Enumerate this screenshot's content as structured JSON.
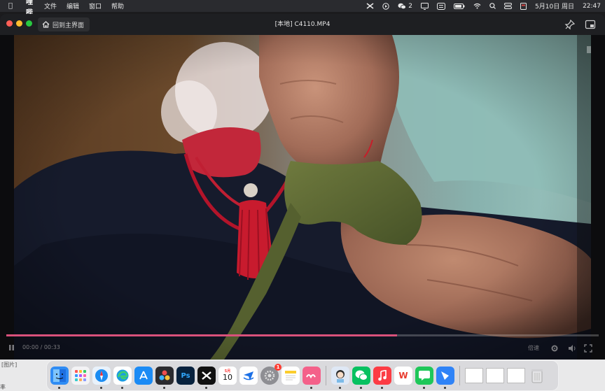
{
  "menubar": {
    "app_name": "哔哩哔哩",
    "items": [
      "文件",
      "编辑",
      "窗口",
      "帮助"
    ],
    "wechat_count": "2",
    "date": "5月10日 周日",
    "time": "22:47"
  },
  "window": {
    "home_button": "回到主界面",
    "title": "[本地] C4110.MP4"
  },
  "player": {
    "progress_fraction": 0.66,
    "time_display": "00:00 / 00:33",
    "speed_label": "倍速"
  },
  "desktop": {
    "file_label": "[图片]",
    "bottom_char": "丰"
  },
  "dock": {
    "calendar_month": "5月",
    "calendar_day": "10",
    "settings_badge": "1",
    "ps_label": "Ps",
    "wps_label": "W"
  },
  "colors": {
    "accent": "#d9517b",
    "menubar_bg": "#2a2b2f",
    "titlebar_bg": "#1e1f22"
  }
}
